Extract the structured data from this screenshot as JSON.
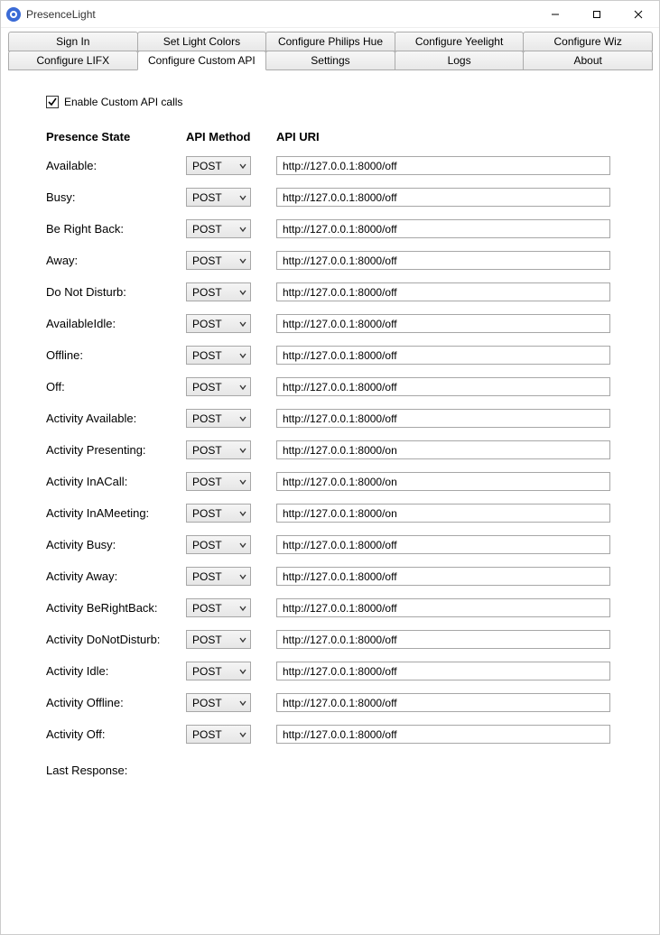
{
  "window": {
    "title": "PresenceLight"
  },
  "tabs": {
    "row1": [
      "Sign In",
      "Set Light Colors",
      "Configure Philips Hue",
      "Configure Yeelight",
      "Configure Wiz"
    ],
    "row2": [
      "Configure LIFX",
      "Configure Custom API",
      "Settings",
      "Logs",
      "About"
    ],
    "active": "Configure Custom API"
  },
  "checkbox": {
    "label": "Enable Custom API calls",
    "checked": true
  },
  "headers": {
    "state": "Presence State",
    "method": "API Method",
    "uri": "API URI"
  },
  "rows": [
    {
      "label": "Available:",
      "method": "POST",
      "uri": "http://127.0.0.1:8000/off"
    },
    {
      "label": "Busy:",
      "method": "POST",
      "uri": "http://127.0.0.1:8000/off"
    },
    {
      "label": "Be Right Back:",
      "method": "POST",
      "uri": "http://127.0.0.1:8000/off"
    },
    {
      "label": "Away:",
      "method": "POST",
      "uri": "http://127.0.0.1:8000/off"
    },
    {
      "label": "Do Not Disturb:",
      "method": "POST",
      "uri": "http://127.0.0.1:8000/off"
    },
    {
      "label": "AvailableIdle:",
      "method": "POST",
      "uri": "http://127.0.0.1:8000/off"
    },
    {
      "label": "Offline:",
      "method": "POST",
      "uri": "http://127.0.0.1:8000/off"
    },
    {
      "label": "Off:",
      "method": "POST",
      "uri": "http://127.0.0.1:8000/off"
    },
    {
      "label": "Activity Available:",
      "method": "POST",
      "uri": "http://127.0.0.1:8000/off"
    },
    {
      "label": "Activity Presenting:",
      "method": "POST",
      "uri": "http://127.0.0.1:8000/on"
    },
    {
      "label": "Activity InACall:",
      "method": "POST",
      "uri": "http://127.0.0.1:8000/on"
    },
    {
      "label": "Activity InAMeeting:",
      "method": "POST",
      "uri": "http://127.0.0.1:8000/on"
    },
    {
      "label": "Activity Busy:",
      "method": "POST",
      "uri": "http://127.0.0.1:8000/off"
    },
    {
      "label": "Activity Away:",
      "method": "POST",
      "uri": "http://127.0.0.1:8000/off"
    },
    {
      "label": "Activity BeRightBack:",
      "method": "POST",
      "uri": "http://127.0.0.1:8000/off"
    },
    {
      "label": "Activity DoNotDisturb:",
      "method": "POST",
      "uri": "http://127.0.0.1:8000/off"
    },
    {
      "label": "Activity Idle:",
      "method": "POST",
      "uri": "http://127.0.0.1:8000/off"
    },
    {
      "label": "Activity Offline:",
      "method": "POST",
      "uri": "http://127.0.0.1:8000/off"
    },
    {
      "label": "Activity Off:",
      "method": "POST",
      "uri": "http://127.0.0.1:8000/off"
    }
  ],
  "last_response_label": "Last Response:"
}
